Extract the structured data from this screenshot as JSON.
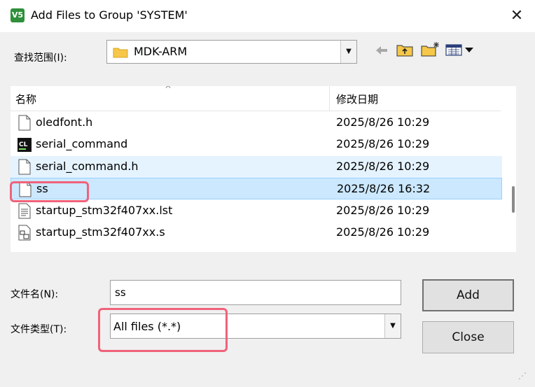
{
  "window": {
    "app_icon_label": "V5",
    "title": "Add Files to Group 'SYSTEM'",
    "close_glyph": "✕"
  },
  "lookin": {
    "label": "查找范围(I):",
    "value": "MDK-ARM"
  },
  "toolbar": {
    "icons": [
      "back-arrow-icon",
      "up-folder-icon",
      "new-folder-icon",
      "view-menu-icon"
    ]
  },
  "filelist": {
    "columns": {
      "name": "名称",
      "date": "修改日期"
    },
    "rows": [
      {
        "name": "oledfont.h",
        "date": "2025/8/26 10:29",
        "icon": "document-icon"
      },
      {
        "name": "serial_command",
        "date": "2025/8/26 10:29",
        "icon": "cl-executable-icon"
      },
      {
        "name": "serial_command.h",
        "date": "2025/8/26 10:29",
        "icon": "document-icon"
      },
      {
        "name": "ss",
        "date": "2025/8/26 16:32",
        "icon": "document-icon"
      },
      {
        "name": "startup_stm32f407xx.lst",
        "date": "2025/8/26 10:29",
        "icon": "text-list-icon"
      },
      {
        "name": "startup_stm32f407xx.s",
        "date": "2025/8/26 10:29",
        "icon": "asm-source-icon"
      }
    ]
  },
  "filename": {
    "label": "文件名(N):",
    "value": "ss"
  },
  "filetype": {
    "label": "文件类型(T):",
    "value": "All files (*.*)"
  },
  "buttons": {
    "add": "Add",
    "close": "Close"
  },
  "colors": {
    "callout": "#f0627a",
    "selected_row": "#cce8ff",
    "hover_row": "#e5f3ff"
  }
}
